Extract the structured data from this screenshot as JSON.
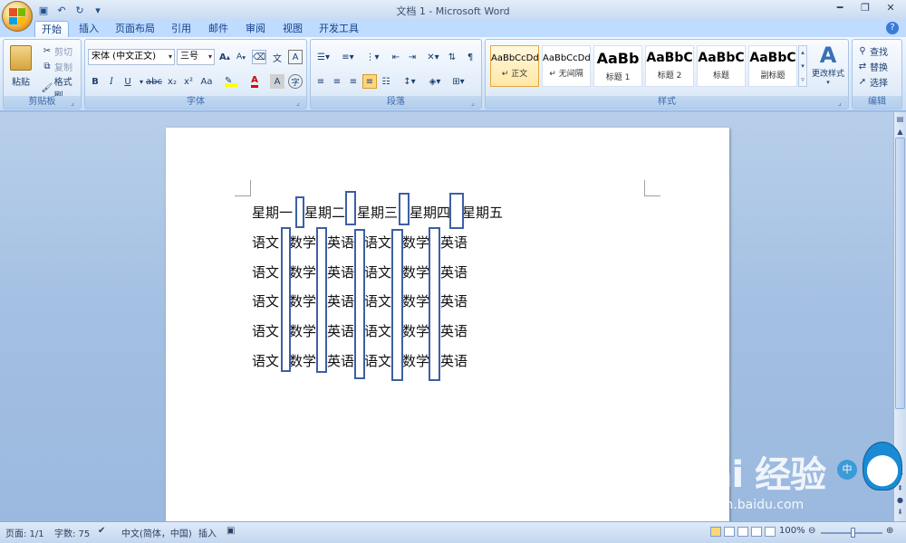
{
  "window": {
    "title": "文档 1 - Microsoft Word"
  },
  "tabs": [
    {
      "label": "开始"
    },
    {
      "label": "插入"
    },
    {
      "label": "页面布局"
    },
    {
      "label": "引用"
    },
    {
      "label": "邮件"
    },
    {
      "label": "审阅"
    },
    {
      "label": "视图"
    },
    {
      "label": "开发工具"
    }
  ],
  "ribbon": {
    "clipboard": {
      "label": "剪贴板",
      "paste": "粘贴",
      "cut": "剪切",
      "copy": "复制",
      "format_painter": "格式刷"
    },
    "font": {
      "label": "字体",
      "font_name": "宋体 (中文正文)",
      "font_size": "三号",
      "bold": "B",
      "italic": "I",
      "underline": "U",
      "strike": "abc",
      "sub": "x₂",
      "sup": "x²",
      "aa": "Aa",
      "grow": "A",
      "shrink": "A",
      "char_border": "A",
      "phonetic": "文",
      "clear": "A"
    },
    "paragraph": {
      "label": "段落"
    },
    "styles": {
      "label": "样式",
      "items": [
        {
          "preview": "AaBbCcDd",
          "name": "↵ 正文"
        },
        {
          "preview": "AaBbCcDd",
          "name": "↵ 无间隔"
        },
        {
          "preview": "AaBb",
          "name": "标题 1"
        },
        {
          "preview": "AaBbC",
          "name": "标题 2"
        },
        {
          "preview": "AaBbC",
          "name": "标题"
        },
        {
          "preview": "AaBbC",
          "name": "副标题"
        }
      ],
      "change_styles": "更改样式"
    },
    "editing": {
      "label": "编辑",
      "find": "查找",
      "replace": "替换",
      "select": "选择"
    }
  },
  "document": {
    "header_row": [
      "星期一",
      "星期二",
      "星期三",
      "星期四",
      "星期五"
    ],
    "rows": [
      [
        "语文",
        "数学",
        "英语",
        "语文",
        "数学",
        "英语"
      ],
      [
        "语文",
        "数学",
        "英语",
        "语文",
        "数学",
        "英语"
      ],
      [
        "语文",
        "数学",
        "英语",
        "语文",
        "数学",
        "英语"
      ],
      [
        "语文",
        "数学",
        "英语",
        "语文",
        "数学",
        "英语"
      ],
      [
        "语文",
        "数学",
        "英语",
        "语文",
        "数学",
        "英语"
      ]
    ]
  },
  "statusbar": {
    "page": "页面: 1/1",
    "words": "字数: 75",
    "language": "中文(简体，中国)",
    "insert": "插入",
    "zoom": "100%"
  },
  "watermark": {
    "brand": "Bai 经验",
    "url": "jingyan.baidu.com"
  },
  "colors": {
    "ribbon_bg": "#dbe8f8",
    "accent": "#15428b",
    "mark": "#3d5fa6"
  }
}
